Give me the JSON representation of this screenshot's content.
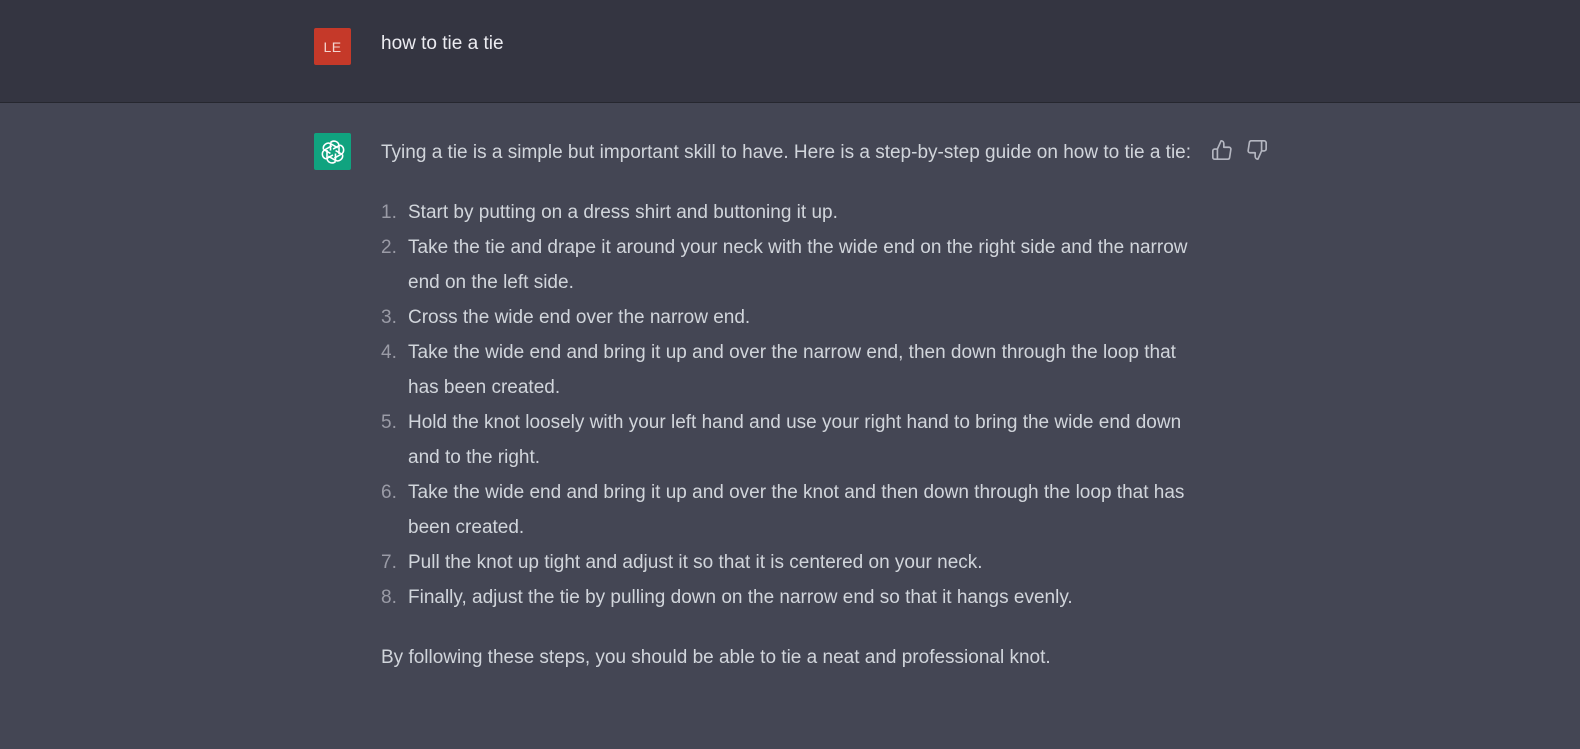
{
  "conversation": {
    "user_message": {
      "avatar_initials": "LE",
      "avatar_color": "#c53929",
      "text": "how to tie a tie"
    },
    "assistant_message": {
      "avatar_icon": "openai-logo-icon",
      "avatar_color": "#10a37f",
      "intro": "Tying a tie is a simple but important skill to have. Here is a step-by-step guide on how to tie a tie:",
      "steps": [
        {
          "num": "1.",
          "text": "Start by putting on a dress shirt and buttoning it up."
        },
        {
          "num": "2.",
          "text": "Take the tie and drape it around your neck with the wide end on the right side and the narrow end on the left side."
        },
        {
          "num": "3.",
          "text": "Cross the wide end over the narrow end."
        },
        {
          "num": "4.",
          "text": "Take the wide end and bring it up and over the narrow end, then down through the loop that has been created."
        },
        {
          "num": "5.",
          "text": "Hold the knot loosely with your left hand and use your right hand to bring the wide end down and to the right."
        },
        {
          "num": "6.",
          "text": "Take the wide end and bring it up and over the knot and then down through the loop that has been created."
        },
        {
          "num": "7.",
          "text": "Pull the knot up tight and adjust it so that it is centered on your neck."
        },
        {
          "num": "8.",
          "text": "Finally, adjust the tie by pulling down on the narrow end so that it hangs evenly."
        }
      ],
      "conclusion": "By following these steps, you should be able to tie a neat and professional knot.",
      "feedback": {
        "thumbs_up_icon": "thumbs-up-icon",
        "thumbs_down_icon": "thumbs-down-icon"
      }
    }
  },
  "colors": {
    "user_row_bg": "#343541",
    "assistant_row_bg": "#444654",
    "text": "#d1d5db",
    "list_number": "#9a9ba6"
  }
}
